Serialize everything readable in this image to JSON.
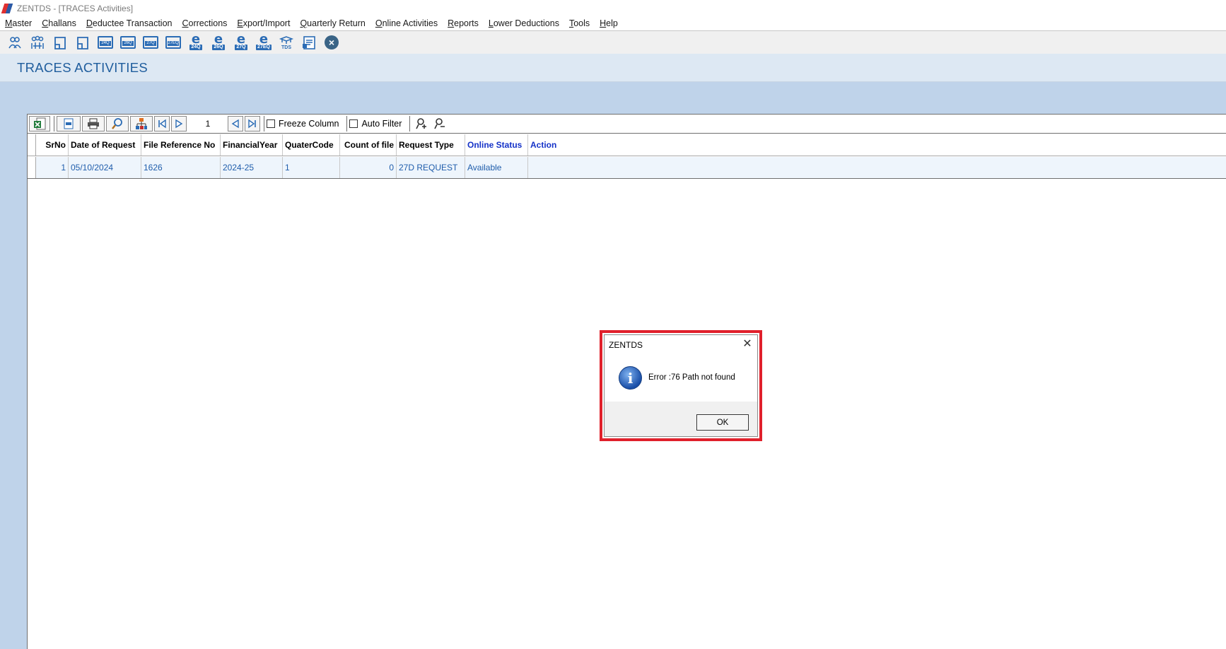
{
  "window": {
    "title": "ZENTDS - [TRACES Activities]"
  },
  "menu": [
    {
      "mnemonic": "M",
      "rest": "aster"
    },
    {
      "mnemonic": "C",
      "rest": "hallans"
    },
    {
      "mnemonic": "D",
      "rest": "eductee Transaction"
    },
    {
      "mnemonic": "C",
      "rest": "orrections"
    },
    {
      "mnemonic": "E",
      "rest": "xport/Import"
    },
    {
      "mnemonic": "Q",
      "rest": "uarterly Return"
    },
    {
      "mnemonic": "O",
      "rest": "nline Activities"
    },
    {
      "mnemonic": "R",
      "rest": "eports"
    },
    {
      "mnemonic": "L",
      "rest": "ower Deductions"
    },
    {
      "mnemonic": "T",
      "rest": "ools"
    },
    {
      "mnemonic": "H",
      "rest": "elp"
    }
  ],
  "toolbar": {
    "icons": [
      "deductor-icon",
      "deductees-icon",
      "form-icon",
      "form-alt-icon"
    ],
    "form_boxes": [
      "24Q",
      "26Q",
      "27Q",
      "27EQ"
    ],
    "e_forms": [
      "24Q",
      "26Q",
      "27Q",
      "27EQ"
    ],
    "tds_label": "TDS"
  },
  "page": {
    "title": "TRACES ACTIVITIES"
  },
  "grid_toolbar": {
    "page_number": "1",
    "freeze_column_label": "Freeze Column",
    "auto_filter_label": "Auto Filter"
  },
  "table": {
    "columns": [
      "SrNo",
      "Date of Request",
      "File Reference No",
      "FinancialYear",
      "QuaterCode",
      "Count of file",
      "Request Type",
      "Online Status",
      "Action"
    ],
    "rows": [
      [
        "1",
        "05/10/2024",
        "1626",
        "2024-25",
        "1",
        "0",
        "27D REQUEST",
        "Available",
        ""
      ]
    ]
  },
  "dialog": {
    "title": "ZENTDS",
    "message": "Error :76 Path not found",
    "ok_label": "OK",
    "highlight_color": "#e0202b"
  }
}
